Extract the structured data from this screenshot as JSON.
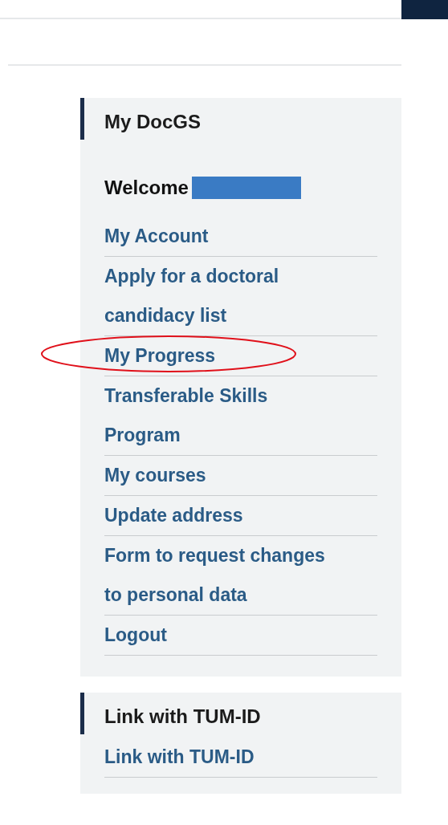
{
  "sections": [
    {
      "title": "My DocGS",
      "welcome": {
        "text": "Welcome",
        "name_redacted": true
      },
      "links": [
        {
          "label": "My Account",
          "circled": false
        },
        {
          "label": "Apply for a doctoral candidacy list",
          "circled": false
        },
        {
          "label": "My Progress",
          "circled": true
        },
        {
          "label": "Transferable Skills Program",
          "circled": false
        },
        {
          "label": "My courses",
          "circled": false
        },
        {
          "label": "Update address",
          "circled": false
        },
        {
          "label": "Form to request changes to personal data",
          "circled": false
        },
        {
          "label": "Logout",
          "circled": false
        }
      ]
    },
    {
      "title": "Link with TUM-ID",
      "links": [
        {
          "label": "Link with TUM-ID",
          "circled": false
        }
      ]
    }
  ]
}
